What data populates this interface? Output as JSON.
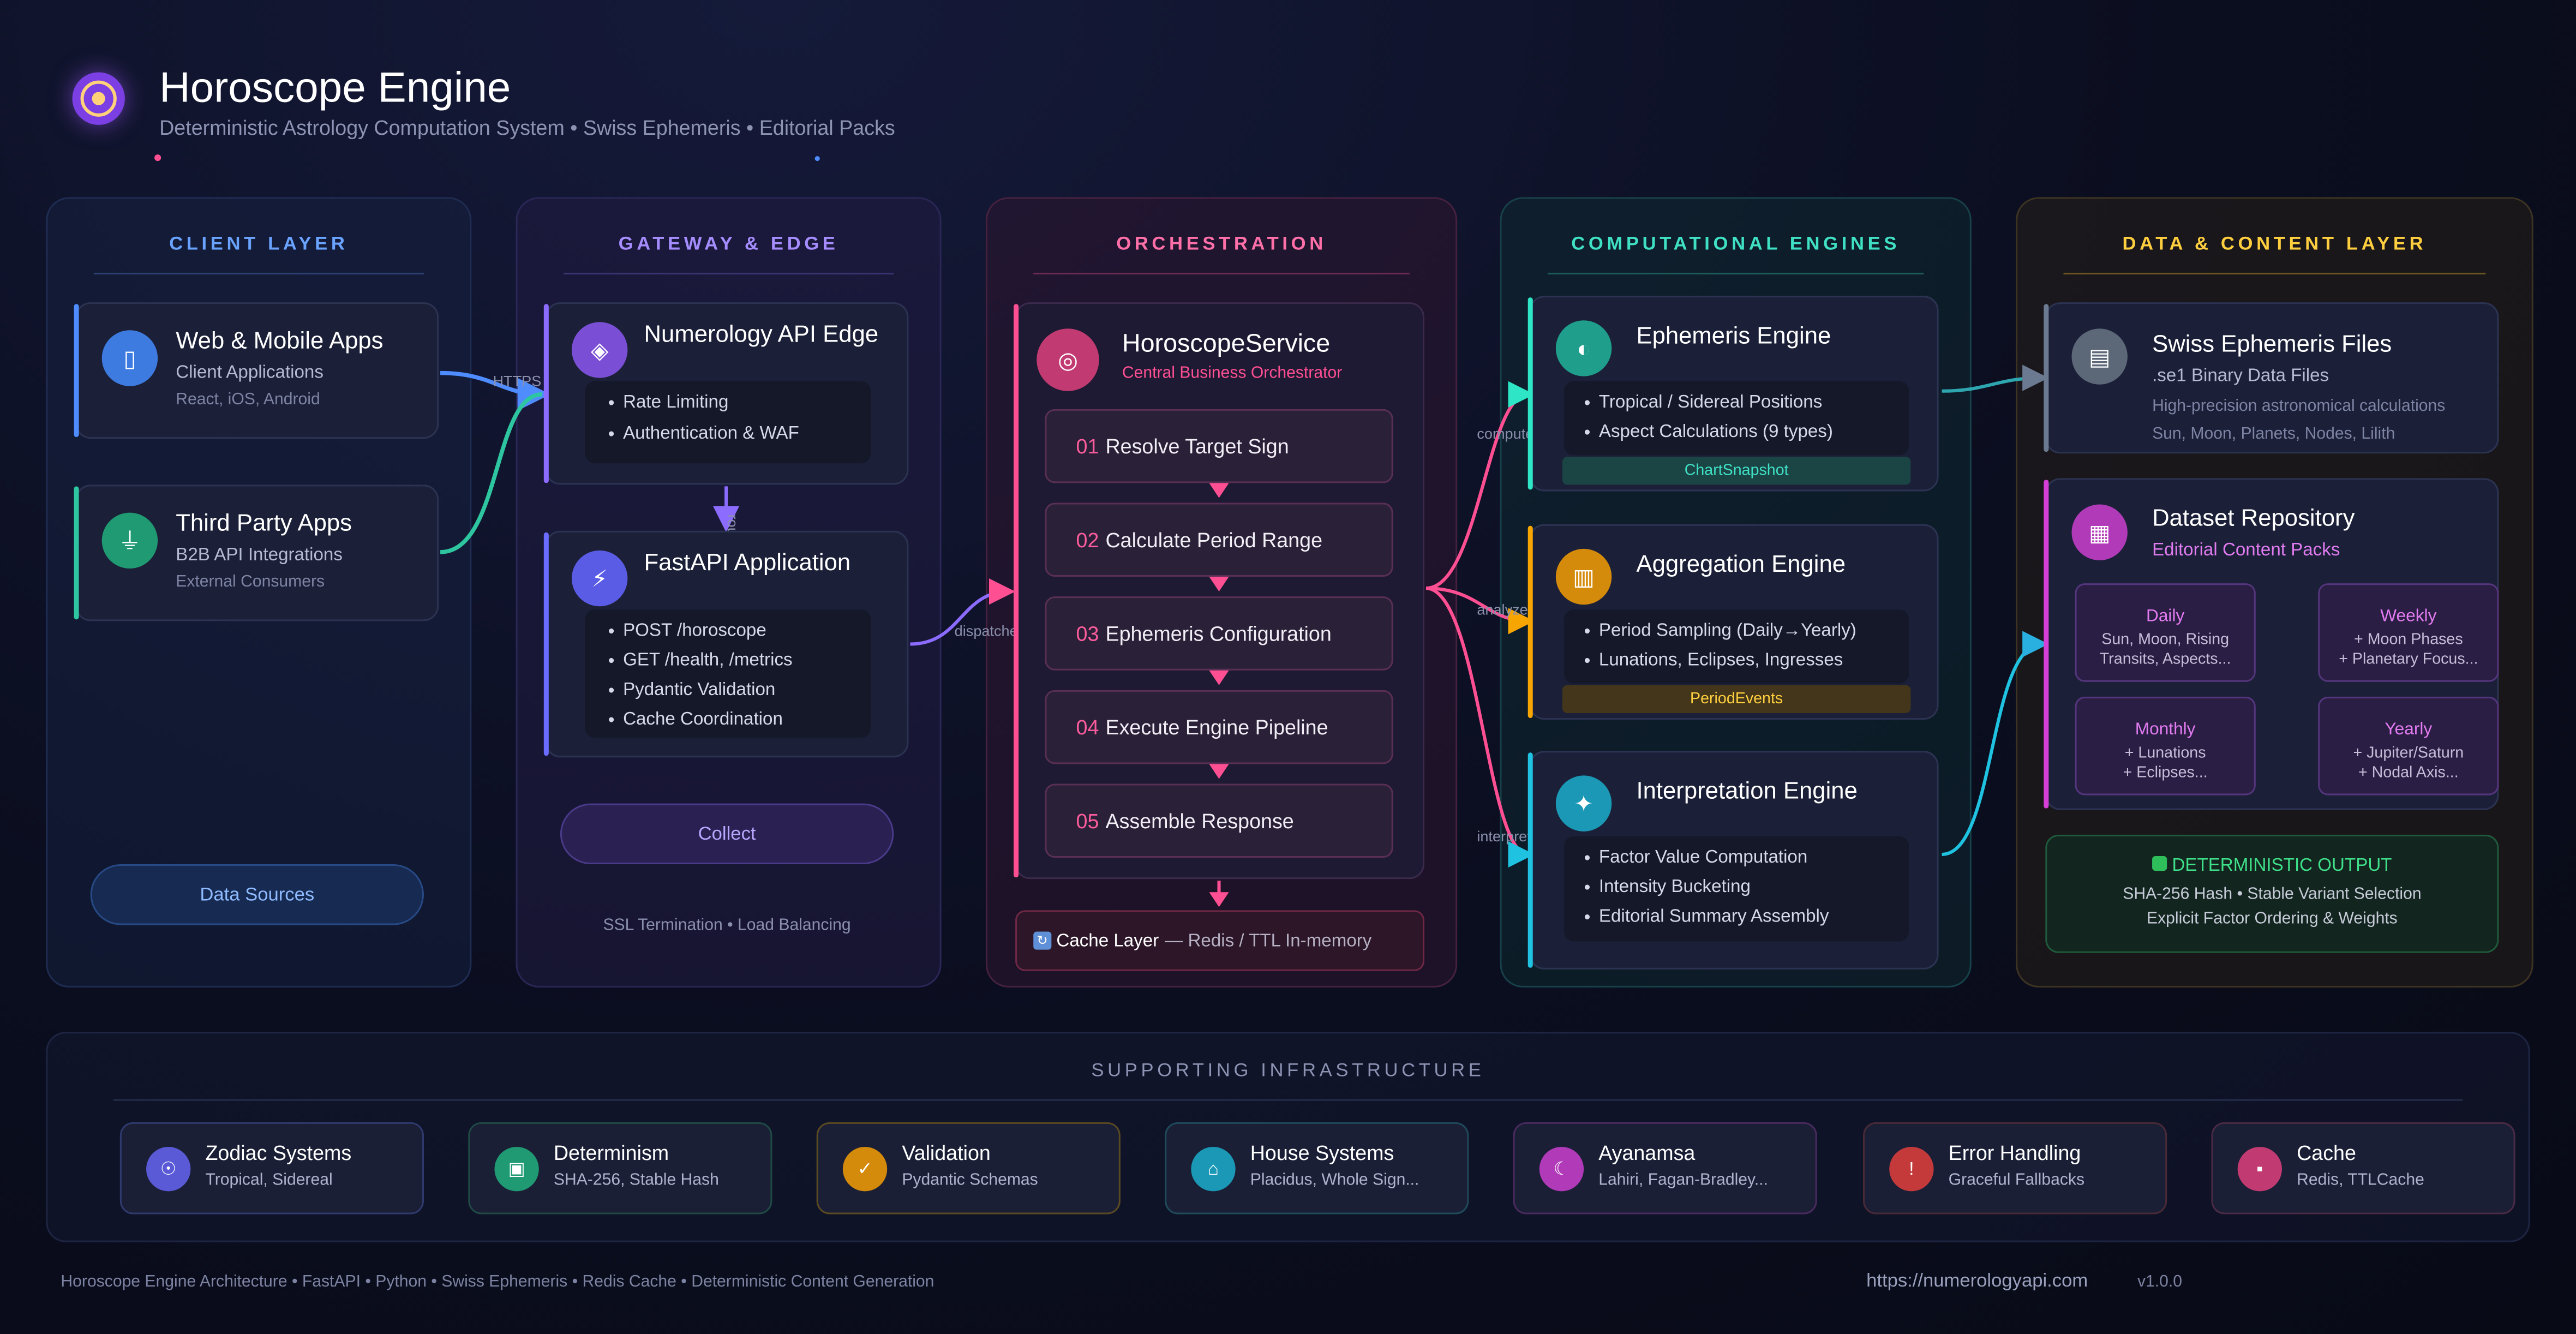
{
  "header": {
    "title": "Horoscope Engine",
    "subtitle": "Deterministic Astrology Computation System • Swiss Ephemeris • Editorial Packs"
  },
  "columns": {
    "client": "CLIENT LAYER",
    "gateway": "GATEWAY & EDGE",
    "orchestration": "ORCHESTRATION",
    "engines": "COMPUTATIONAL ENGINES",
    "data": "DATA & CONTENT LAYER"
  },
  "client": {
    "web": {
      "title": "Web & Mobile Apps",
      "sub": "Client Applications",
      "sub2": "React, iOS, Android",
      "icon": "mobile-phone-icon"
    },
    "third": {
      "title": "Third Party Apps",
      "sub": "B2B API Integrations",
      "sub2": "External Consumers",
      "icon": "plug-icon"
    },
    "data_sources": "Data Sources"
  },
  "gateway": {
    "edge": {
      "title": "Numerology API Edge",
      "bullets": [
        "Rate Limiting",
        "Authentication & WAF"
      ],
      "icon": "shield-icon"
    },
    "fastapi": {
      "title": "FastAPI Application",
      "bullets": [
        "POST /horoscope",
        "GET /health, /metrics",
        "Pydantic Validation",
        "Cache Coordination"
      ],
      "icon": "lightning-icon"
    },
    "collect": "Collect",
    "footer": "SSL Termination • Load Balancing"
  },
  "orchestration": {
    "service": {
      "title": "HoroscopeService",
      "sub": "Central Business Orchestrator",
      "icon": "target-icon"
    },
    "steps": [
      {
        "num": "01",
        "label": "Resolve Target Sign"
      },
      {
        "num": "02",
        "label": "Calculate Period Range"
      },
      {
        "num": "03",
        "label": "Ephemeris Configuration"
      },
      {
        "num": "04",
        "label": "Execute Engine Pipeline"
      },
      {
        "num": "05",
        "label": "Assemble Response"
      }
    ],
    "cache": {
      "title": "Cache Layer",
      "detail": "— Redis / TTL In-memory",
      "icon": "refresh-icon"
    }
  },
  "engines": {
    "ephemeris": {
      "title": "Ephemeris Engine",
      "bullets": [
        "Tropical / Sidereal Positions",
        "Aspect Calculations (9 types)"
      ],
      "badge": "ChartSnapshot",
      "icon": "planet-icon"
    },
    "aggregation": {
      "title": "Aggregation Engine",
      "bullets": [
        "Period Sampling (Daily→Yearly)",
        "Lunations, Eclipses, Ingresses"
      ],
      "badge": "PeriodEvents",
      "icon": "bar-chart-icon"
    },
    "interpretation": {
      "title": "Interpretation Engine",
      "bullets": [
        "Factor Value Computation",
        "Intensity Bucketing",
        "Editorial Summary Assembly"
      ],
      "icon": "sparkles-icon"
    }
  },
  "data_layer": {
    "swiss": {
      "title": "Swiss Ephemeris Files",
      "sub": ".se1 Binary Data Files",
      "lines": [
        "High-precision astronomical calculations",
        "Sun, Moon, Planets, Nodes, Lilith"
      ],
      "icon": "folder-icon"
    },
    "dataset": {
      "title": "Dataset Repository",
      "sub": "Editorial Content Packs",
      "icon": "books-icon"
    },
    "packs": [
      {
        "title": "Daily",
        "lines": [
          "Sun, Moon, Rising",
          "Transits, Aspects..."
        ]
      },
      {
        "title": "Weekly",
        "lines": [
          "+ Moon Phases",
          "+ Planetary Focus..."
        ]
      },
      {
        "title": "Monthly",
        "lines": [
          "+ Lunations",
          "+ Eclipses..."
        ]
      },
      {
        "title": "Yearly",
        "lines": [
          "+ Jupiter/Saturn",
          "+ Nodal Axis..."
        ]
      }
    ],
    "output": {
      "title": "DETERMINISTIC OUTPUT",
      "lines": [
        "SHA-256 Hash • Stable Variant Selection",
        "Explicit Factor Ordering & Weights"
      ]
    }
  },
  "edges": {
    "https": "HTTPS",
    "routes": "routes",
    "dispatches": "dispatches",
    "compute": "compute",
    "analyze": "analyze",
    "interpret": "interpret"
  },
  "infrastructure": {
    "title": "SUPPORTING INFRASTRUCTURE",
    "items": [
      {
        "title": "Zodiac Systems",
        "sub": "Tropical, Sidereal",
        "icon": "zodiac-icon"
      },
      {
        "title": "Determinism",
        "sub": "SHA-256, Stable Hash",
        "icon": "lock-icon"
      },
      {
        "title": "Validation",
        "sub": "Pydantic Schemas",
        "icon": "checkmark-icon"
      },
      {
        "title": "House Systems",
        "sub": "Placidus, Whole Sign...",
        "icon": "house-icon"
      },
      {
        "title": "Ayanamsa",
        "sub": "Lahiri, Fagan-Bradley...",
        "icon": "moon-icon"
      },
      {
        "title": "Error Handling",
        "sub": "Graceful Fallbacks",
        "icon": "warning-icon"
      },
      {
        "title": "Cache",
        "sub": "Redis, TTLCache",
        "icon": "disk-icon"
      }
    ]
  },
  "footer": {
    "left": "Horoscope Engine Architecture • FastAPI • Python • Swiss Ephemeris • Redis Cache • Deterministic Content Generation",
    "url": "https://numerologyapi.com",
    "version": "v1.0.0"
  },
  "colors": {
    "client": "#4f8cff",
    "gateway": "#8b6cff",
    "orchestration": "#ff4f93",
    "engines": "#2ee6c5",
    "data": "#ffcf3f"
  }
}
